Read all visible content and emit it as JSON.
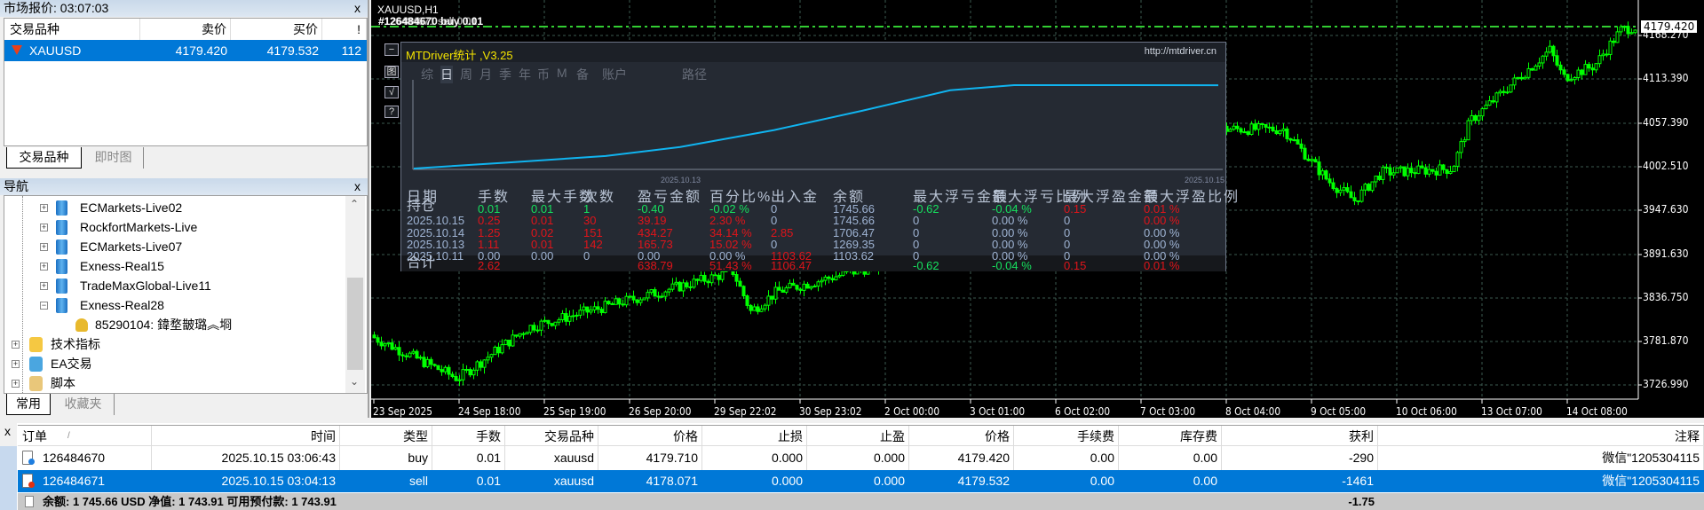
{
  "market_watch": {
    "title": "市场报价: 03:07:03",
    "columns": [
      "交易品种",
      "卖价",
      "买价",
      "!"
    ],
    "rows": [
      {
        "symbol": "XAUUSD",
        "bid": "4179.420",
        "ask": "4179.532",
        "spread": "112"
      }
    ],
    "tabs": [
      "交易品种",
      "即时图"
    ],
    "close": "x"
  },
  "navigator": {
    "title": "导航",
    "close": "x",
    "servers": [
      "ECMarkets-Live02",
      "RockfortMarkets-Live",
      "ECMarkets-Live07",
      "Exness-Real15",
      "TradeMaxGlobal-Live11",
      "Exness-Real28"
    ],
    "account": "85290104: 鍏堥皵璐︽埛",
    "folders": [
      "技术指标",
      "EA交易",
      "脚本"
    ],
    "tabs": [
      "常用",
      "收藏夹"
    ]
  },
  "chart": {
    "title": "XAUUSD,H1",
    "order_labels": [
      "#126484670 buy 0.01",
      "#126484671 sell 0.01"
    ],
    "current_price": "4179.420",
    "price_labels": [
      "4168.270",
      "4113.390",
      "4057.390",
      "4002.510",
      "3947.630",
      "3891.630",
      "3836.750",
      "3781.870",
      "3726.990"
    ],
    "time_labels": [
      "23 Sep 2025",
      "24 Sep 18:00",
      "25 Sep 19:00",
      "26 Sep 20:00",
      "29 Sep 22:02",
      "30 Sep 23:02",
      "2 Oct 00:00",
      "3 Oct 01:00",
      "6 Oct 02:00",
      "7 Oct 03:00",
      "8 Oct 04:00",
      "9 Oct 05:00",
      "10 Oct 06:00",
      "13 Oct 07:00",
      "14 Oct 08:00"
    ],
    "candle_color": "#00ff00",
    "line_color": "#32cd32"
  },
  "mtdriver": {
    "title": "MTDriver统计 ,V3.25",
    "url": "http://mtdriver.cn",
    "side_buttons": [
      "−",
      "图",
      "√",
      "?"
    ],
    "tabs": [
      "综",
      "日",
      "周",
      "月",
      "季",
      "年",
      "币",
      "M",
      "备",
      "账户",
      "路径"
    ],
    "active_tab": "日",
    "curve_dates": [
      "2025.10.13",
      "2025.10.15"
    ],
    "headers": [
      "日期",
      "手数",
      "最大手数",
      "次数",
      "盈亏金额",
      "百分比%",
      "出入金",
      "余额",
      "最大浮亏金额",
      "最大浮亏比例",
      "最大浮盈金额",
      "最大浮盈比例"
    ],
    "rows": [
      [
        "持仓",
        "0.01",
        "0.01",
        "1",
        "-0.40",
        "-0.02 %",
        "0",
        "1745.66",
        "-0.62",
        "-0.04 %",
        "0.15",
        "0.01 %"
      ],
      [
        "2025.10.15",
        "0.25",
        "0.01",
        "30",
        "39.19",
        "2.30 %",
        "0",
        "1745.66",
        "0",
        "0.00 %",
        "0",
        "0.00 %"
      ],
      [
        "2025.10.14",
        "1.25",
        "0.02",
        "151",
        "434.27",
        "34.14 %",
        "2.85",
        "1706.47",
        "0",
        "0.00 %",
        "0",
        "0.00 %"
      ],
      [
        "2025.10.13",
        "1.11",
        "0.01",
        "142",
        "165.73",
        "15.02 %",
        "0",
        "1269.35",
        "0",
        "0.00 %",
        "0",
        "0.00 %"
      ],
      [
        "2025.10.11",
        "0.00",
        "0.00",
        "0",
        "0.00",
        "0.00 %",
        "1103.62",
        "1103.62",
        "0",
        "0.00 %",
        "0",
        "0.00 %"
      ],
      [
        "合计",
        "2.62",
        "",
        "",
        "638.79",
        "51.43 %",
        "1106.47",
        "",
        "-0.62",
        "-0.04 %",
        "0.15",
        "0.01 %"
      ]
    ],
    "row_colors": [
      [
        "",
        "g",
        "g",
        "g",
        "g",
        "g",
        "",
        "",
        "g",
        "g",
        "r",
        "r"
      ],
      [
        "",
        "r",
        "r",
        "r",
        "r",
        "r",
        "",
        "",
        "",
        "",
        "",
        "r"
      ],
      [
        "",
        "r",
        "r",
        "r",
        "r",
        "r",
        "r",
        "",
        "",
        "",
        "",
        ""
      ],
      [
        "",
        "r",
        "r",
        "r",
        "r",
        "r",
        "",
        "",
        "",
        "",
        "",
        ""
      ],
      [
        "",
        "",
        "",
        "",
        "",
        "",
        "r",
        "",
        "",
        "",
        "",
        ""
      ],
      [
        "",
        "r",
        "",
        "",
        "r",
        "r",
        "r",
        "",
        "g",
        "g",
        "r",
        "r"
      ]
    ],
    "equity": [
      1103.62,
      1150,
      1200,
      1269.35,
      1400,
      1550,
      1706.47,
      1745.66,
      1745.66,
      1745.0
    ]
  },
  "terminal": {
    "close": "x",
    "columns": [
      "订单",
      "时间",
      "类型",
      "手数",
      "交易品种",
      "价格",
      "止损",
      "止盈",
      "价格",
      "手续费",
      "库存费",
      "获利",
      "注释"
    ],
    "sort_mark": "/",
    "orders": [
      [
        "126484670",
        "2025.10.15 03:06:43",
        "buy",
        "0.01",
        "xauusd",
        "4179.710",
        "0.000",
        "0.000",
        "4179.420",
        "0.00",
        "0.00",
        "-290",
        "微信\"1205304115"
      ],
      [
        "126484671",
        "2025.10.15 03:04:13",
        "sell",
        "0.01",
        "xauusd",
        "4178.071",
        "0.000",
        "0.000",
        "4179.532",
        "0.00",
        "0.00",
        "-1461",
        "微信\"1205304115"
      ]
    ],
    "summary": "余额: 1 745.66 USD  净值: 1 743.91  可用预付款: 1 743.91",
    "total_profit": "-1.75"
  }
}
